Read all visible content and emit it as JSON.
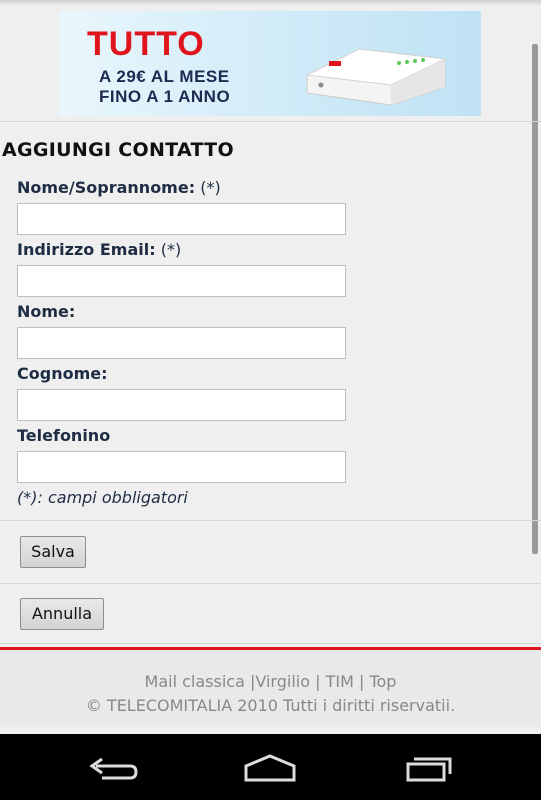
{
  "banner": {
    "headline": "TUTTO",
    "line1": "A 29€ AL MESE",
    "line2": "FINO A 1 ANNO",
    "accent_color": "#e0141b"
  },
  "form": {
    "title": "AGGIUNGI CONTATTO",
    "fields": [
      {
        "label": "Nome/Soprannome:",
        "required_mark": "(*)",
        "value": ""
      },
      {
        "label": "Indirizzo Email:",
        "required_mark": "(*)",
        "value": ""
      },
      {
        "label": "Nome:",
        "required_mark": "",
        "value": ""
      },
      {
        "label": "Cognome:",
        "required_mark": "",
        "value": ""
      },
      {
        "label": "Telefonino",
        "required_mark": "",
        "value": ""
      }
    ],
    "required_note": "(*): campi obbligatori",
    "save_label": "Salva",
    "cancel_label": "Annulla"
  },
  "footer": {
    "link_mail": "Mail classica",
    "link_virgilio": "Virgilio",
    "link_tim": "TIM",
    "link_top": "Top",
    "copyright": "© TELECOMITALIA 2010 Tutti i diritti riservatii.",
    "accent_color": "#e2151c"
  },
  "navbar": {
    "back_icon": "back-icon",
    "home_icon": "home-icon",
    "recents_icon": "recents-icon"
  }
}
